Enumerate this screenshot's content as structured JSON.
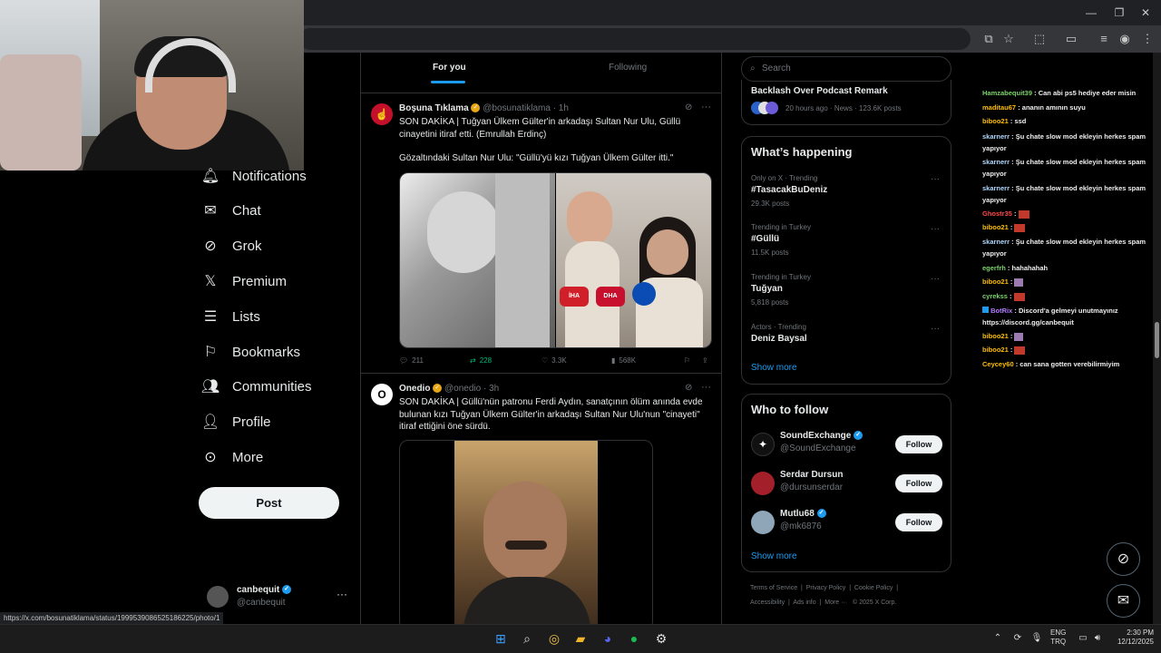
{
  "nav": {
    "items": [
      {
        "label": "Notifications",
        "icon": "bell-icon"
      },
      {
        "label": "Chat",
        "icon": "mail-icon"
      },
      {
        "label": "Grok",
        "icon": "grok-icon"
      },
      {
        "label": "Premium",
        "icon": "x-logo-icon"
      },
      {
        "label": "Lists",
        "icon": "list-icon"
      },
      {
        "label": "Bookmarks",
        "icon": "bookmark-icon"
      },
      {
        "label": "Communities",
        "icon": "people-icon"
      },
      {
        "label": "Profile",
        "icon": "person-icon"
      },
      {
        "label": "More",
        "icon": "more-circle-icon"
      }
    ],
    "post_label": "Post",
    "account": {
      "name": "canbequit",
      "handle": "@canbequit"
    }
  },
  "status_url": "https://x.com/bosunatiklama/status/1999539086525186225/photo/1",
  "feed": {
    "tabs": [
      {
        "label": "For you"
      },
      {
        "label": "Following"
      }
    ],
    "tweets": [
      {
        "name": "Boşuna Tıklama",
        "handle": "@bosunatiklama",
        "time": "· 1h",
        "text1": "SON DAKİKA | Tuğyan Ülkem Gülter'in arkadaşı Sultan Nur Ulu, Güllü cinayetini itiraf etti. (Emrullah Erdinç)",
        "text2": "Gözaltındaki Sultan Nur Ulu: \"Güllü'yü kızı Tuğyan Ülkem Gülter itti.\"",
        "replies": "211",
        "reposts": "228",
        "likes": "3.3K",
        "views": "568K"
      },
      {
        "name": "Onedio",
        "handle": "@onedio",
        "time": "· 3h",
        "text1": "SON DAKİKA | Güllü'nün patronu Ferdi Aydın, sanatçının ölüm anında evde bulunan kızı Tuğyan Ülkem Gülter'in arkadaşı Sultan Nur Ulu'nun \"cinayeti\" itiraf ettiğini öne sürdü."
      }
    ]
  },
  "right": {
    "search_placeholder": "Search",
    "top_trend": {
      "title": "Backlash Over Podcast Remark",
      "meta": "20 hours ago · News · 123.6K posts"
    },
    "happening_title": "What’s happening",
    "trends": [
      {
        "cat": "Only on X · Trending",
        "name": "#TasacakBuDeniz",
        "count": "29.3K posts"
      },
      {
        "cat": "Trending in Turkey",
        "name": "#Güllü",
        "count": "11.5K posts"
      },
      {
        "cat": "Trending in Turkey",
        "name": "Tuğyan",
        "count": "5,818 posts"
      },
      {
        "cat": "Actors · Trending",
        "name": "Deniz Baysal",
        "count": ""
      }
    ],
    "show_more": "Show more",
    "who_title": "Who to follow",
    "follows": [
      {
        "name": "SoundExchange",
        "handle": "@SoundExchange",
        "verified": true
      },
      {
        "name": "Serdar Dursun",
        "handle": "@dursunserdar",
        "verified": false
      },
      {
        "name": "Mutlu68",
        "handle": "@mk6876",
        "verified": true
      }
    ],
    "follow_label": "Follow",
    "footer1": [
      "Terms of Service",
      "Privacy Policy",
      "Cookie Policy"
    ],
    "footer2": [
      "Accessibility",
      "Ads info",
      "More ···",
      "© 2025 X Corp."
    ]
  },
  "chat": [
    {
      "user": "Hamzabequit39",
      "color": "#7dd36c",
      "msg": "Can abi ps5 hediye eder misin"
    },
    {
      "user": "maditau67",
      "color": "#ffbf00",
      "msg": "ananın amının suyu"
    },
    {
      "user": "biboo21",
      "color": "#ffbf00",
      "msg": "ssd"
    },
    {
      "user": "skarnerr",
      "color": "#b0d8ff",
      "msg": "Şu chate slow mod ekleyin herkes spam yapıyor"
    },
    {
      "user": "skarnerr",
      "color": "#b0d8ff",
      "msg": "Şu chate slow mod ekleyin herkes spam yapıyor"
    },
    {
      "user": "skarnerr",
      "color": "#b0d8ff",
      "msg": "Şu chate slow mod ekleyin herkes spam yapıyor"
    },
    {
      "user": "Ghostr35",
      "color": "#ff4a4a",
      "msg": ""
    },
    {
      "user": "biboo21",
      "color": "#ffbf00",
      "msg": ""
    },
    {
      "user": "skarnerr",
      "color": "#b0d8ff",
      "msg": "Şu chate slow mod ekleyin herkes spam yapıyor"
    },
    {
      "user": "egerfrh",
      "color": "#7dd36c",
      "msg": "hahahahah"
    },
    {
      "user": "biboo21",
      "color": "#ffbf00",
      "msg": ""
    },
    {
      "user": "cyrekss",
      "color": "#7dd36c",
      "msg": ""
    },
    {
      "user": "BotRix",
      "color": "#b47bff",
      "msg": "Discord'a gelmeyi unutmayınız https://discord.gg/canbequit"
    },
    {
      "user": "biboo21",
      "color": "#ffbf00",
      "msg": ""
    },
    {
      "user": "biboo21",
      "color": "#ffbf00",
      "msg": ""
    },
    {
      "user": "Ceycey60",
      "color": "#ffbf00",
      "msg": "can sana gotten verebilirmiyim"
    }
  ],
  "taskbar": {
    "lang1": "ENG",
    "lang2": "TRQ",
    "time": "2:30 PM",
    "date": "12/12/2025"
  }
}
